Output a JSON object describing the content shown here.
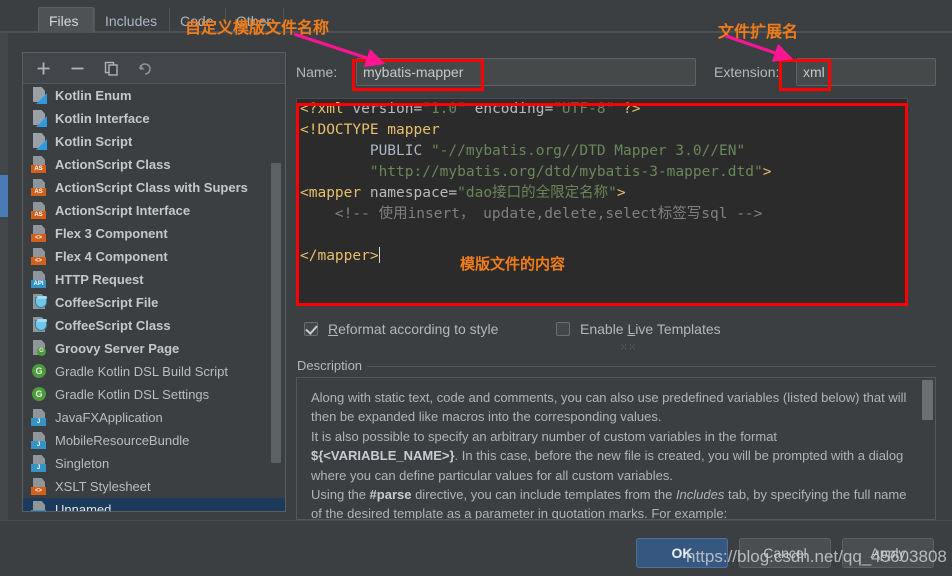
{
  "window": {
    "background": "#3c3f41",
    "accent": "#365880",
    "annotation_color": "#f07d1a",
    "highlight_box_color": "#ff0000",
    "arrow_color": "#ff1493"
  },
  "tabs": [
    {
      "label": "Files",
      "active": true
    },
    {
      "label": "Includes",
      "active": false
    },
    {
      "label": "Code",
      "active": false
    },
    {
      "label": "Other",
      "active": false
    }
  ],
  "list_toolbar": [
    {
      "name": "add-icon",
      "glyph": "+",
      "title": "Add"
    },
    {
      "name": "remove-icon",
      "glyph": "−",
      "title": "Remove"
    },
    {
      "name": "copy-icon",
      "glyph": "copy",
      "title": "Copy"
    },
    {
      "name": "revert-icon",
      "glyph": "undo",
      "title": "Reset"
    }
  ],
  "template_list": [
    {
      "label": "Kotlin Enum",
      "icon": "kotlin-file-icon",
      "bold": true,
      "selected": false
    },
    {
      "label": "Kotlin Interface",
      "icon": "kotlin-file-icon",
      "bold": true,
      "selected": false
    },
    {
      "label": "Kotlin Script",
      "icon": "kotlin-file-icon",
      "bold": true,
      "selected": false
    },
    {
      "label": "ActionScript Class",
      "icon": "actionscript-file-icon",
      "bold": true,
      "selected": false
    },
    {
      "label": "ActionScript Class with Supers",
      "icon": "actionscript-file-icon",
      "bold": true,
      "selected": false
    },
    {
      "label": "ActionScript Interface",
      "icon": "actionscript-file-icon",
      "bold": true,
      "selected": false
    },
    {
      "label": "Flex 3 Component",
      "icon": "flex-file-icon",
      "bold": true,
      "selected": false
    },
    {
      "label": "Flex 4 Component",
      "icon": "flex-file-icon",
      "bold": true,
      "selected": false
    },
    {
      "label": "HTTP Request",
      "icon": "http-request-file-icon",
      "bold": true,
      "selected": false
    },
    {
      "label": "CoffeeScript File",
      "icon": "coffeescript-file-icon",
      "bold": true,
      "selected": false
    },
    {
      "label": "CoffeeScript Class",
      "icon": "coffeescript-file-icon",
      "bold": true,
      "selected": false
    },
    {
      "label": "Groovy Server Page",
      "icon": "groovy-file-icon",
      "bold": true,
      "selected": false
    },
    {
      "label": "Gradle Kotlin DSL Build Script",
      "icon": "gradle-icon",
      "bold": false,
      "selected": false
    },
    {
      "label": "Gradle Kotlin DSL Settings",
      "icon": "gradle-icon",
      "bold": false,
      "selected": false
    },
    {
      "label": "JavaFXApplication",
      "icon": "java-file-icon",
      "bold": false,
      "selected": false
    },
    {
      "label": "MobileResourceBundle",
      "icon": "java-file-icon",
      "bold": false,
      "selected": false
    },
    {
      "label": "Singleton",
      "icon": "java-file-icon",
      "bold": false,
      "selected": false
    },
    {
      "label": "XSLT Stylesheet",
      "icon": "xslt-file-icon",
      "bold": false,
      "selected": false
    },
    {
      "label": "Unnamed",
      "icon": "java-file-icon",
      "bold": false,
      "selected": true
    }
  ],
  "form": {
    "name_label": "Name:",
    "name_value": "mybatis-mapper",
    "name_placeholder": "",
    "extension_label": "Extension:",
    "extension_value": "xml",
    "extension_placeholder": ""
  },
  "editor": {
    "lines": [
      {
        "segments": [
          {
            "t": "<?xml ",
            "c": "tag"
          },
          {
            "t": "version=",
            "c": "attr"
          },
          {
            "t": "\"1.0\"",
            "c": "str"
          },
          {
            "t": " encoding=",
            "c": "attr"
          },
          {
            "t": "\"UTF-8\"",
            "c": "str"
          },
          {
            "t": " ?>",
            "c": "tag"
          }
        ]
      },
      {
        "segments": [
          {
            "t": "<!DOCTYPE mapper",
            "c": "tag"
          }
        ]
      },
      {
        "segments": [
          {
            "t": "        PUBLIC ",
            "c": "plain"
          },
          {
            "t": "\"-//mybatis.org//DTD Mapper 3.0//EN\"",
            "c": "str"
          }
        ]
      },
      {
        "segments": [
          {
            "t": "        ",
            "c": "plain"
          },
          {
            "t": "\"http://mybatis.org/dtd/mybatis-3-mapper.dtd\"",
            "c": "str"
          },
          {
            "t": ">",
            "c": "tag"
          }
        ]
      },
      {
        "segments": [
          {
            "t": "<mapper ",
            "c": "tag"
          },
          {
            "t": "namespace=",
            "c": "attr"
          },
          {
            "t": "\"dao接口的全限定名称\"",
            "c": "str"
          },
          {
            "t": ">",
            "c": "tag"
          }
        ]
      },
      {
        "segments": [
          {
            "t": "    <!-- 使用insert， update,delete,select标签写sql -->",
            "c": "cmt"
          }
        ]
      },
      {
        "segments": [
          {
            "t": "",
            "c": "plain"
          }
        ]
      },
      {
        "segments": [
          {
            "t": "</mapper>",
            "c": "tag"
          }
        ],
        "caret": true
      }
    ]
  },
  "options": {
    "reformat_label": "Reformat according to style",
    "reformat_checked": true,
    "live_templates_label": "Enable Live Templates",
    "live_templates_checked": false
  },
  "description": {
    "title": "Description",
    "paragraphs": [
      "Along with static text, code and comments, you can also use predefined variables (listed below) that will then be expanded like macros into the corresponding values.",
      "It is also possible to specify an arbitrary number of custom variables in the format ${<VARIABLE_NAME>}. In this case, before the new file is created, you will be prompted with a dialog where you can define particular values for all custom variables.",
      "Using the #parse directive, you can include templates from the Includes tab, by specifying the full name of the desired template as a parameter in quotation marks. For example:"
    ]
  },
  "buttons": {
    "ok": "OK",
    "cancel": "Cancel",
    "apply": "Apply"
  },
  "annotations": {
    "name_note": "自定义模版文件名称",
    "extension_note": "文件扩展名",
    "content_note": "模版文件的内容"
  },
  "watermark": {
    "text": "https://blog.csdn.net/qq_45603808"
  }
}
